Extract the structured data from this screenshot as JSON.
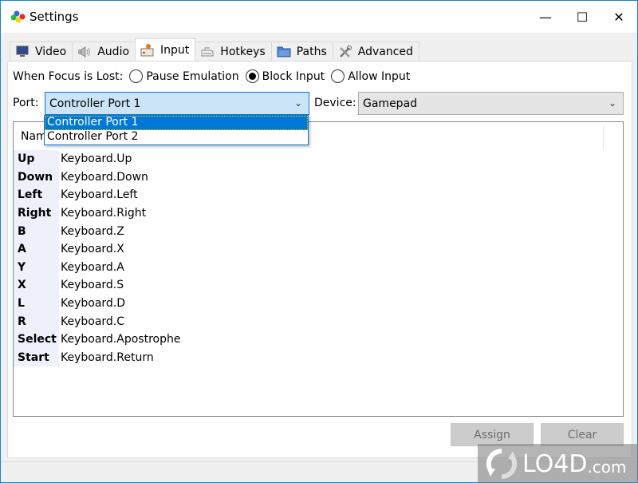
{
  "window": {
    "title": "Settings",
    "controls": {
      "minimize": "—",
      "maximize": "☐",
      "close": "✕"
    }
  },
  "tabs": [
    {
      "label": "Video",
      "icon": "monitor-icon",
      "active": false
    },
    {
      "label": "Audio",
      "icon": "speaker-icon",
      "active": false
    },
    {
      "label": "Input",
      "icon": "joystick-icon",
      "active": true
    },
    {
      "label": "Hotkeys",
      "icon": "keyboard-icon",
      "active": false
    },
    {
      "label": "Paths",
      "icon": "folder-icon",
      "active": false
    },
    {
      "label": "Advanced",
      "icon": "tools-icon",
      "active": false
    }
  ],
  "focus": {
    "label": "When Focus is Lost:",
    "options": [
      {
        "label": "Pause Emulation",
        "selected": false
      },
      {
        "label": "Block Input",
        "selected": true
      },
      {
        "label": "Allow Input",
        "selected": false
      }
    ]
  },
  "port": {
    "label": "Port:",
    "value": "Controller Port 1",
    "options": [
      "Controller Port 1",
      "Controller Port 2"
    ],
    "highlighted_index": 0
  },
  "device": {
    "label": "Device:",
    "value": "Gamepad"
  },
  "mapping_list": {
    "header": "Name",
    "rows": [
      {
        "name": "Up",
        "mapping": "Keyboard.Up"
      },
      {
        "name": "Down",
        "mapping": "Keyboard.Down"
      },
      {
        "name": "Left",
        "mapping": "Keyboard.Left"
      },
      {
        "name": "Right",
        "mapping": "Keyboard.Right"
      },
      {
        "name": "B",
        "mapping": "Keyboard.Z"
      },
      {
        "name": "A",
        "mapping": "Keyboard.X"
      },
      {
        "name": "Y",
        "mapping": "Keyboard.A"
      },
      {
        "name": "X",
        "mapping": "Keyboard.S"
      },
      {
        "name": "L",
        "mapping": "Keyboard.D"
      },
      {
        "name": "R",
        "mapping": "Keyboard.C"
      },
      {
        "name": "Select",
        "mapping": "Keyboard.Apostrophe"
      },
      {
        "name": "Start",
        "mapping": "Keyboard.Return"
      }
    ]
  },
  "buttons": {
    "assign": "Assign",
    "clear": "Clear"
  },
  "watermark": {
    "brand": "LO4D",
    "suffix": ".com"
  },
  "colors": {
    "accent": "#0078d7",
    "selection": "#cce4f7",
    "row_key_bg": "#eef0fb"
  }
}
